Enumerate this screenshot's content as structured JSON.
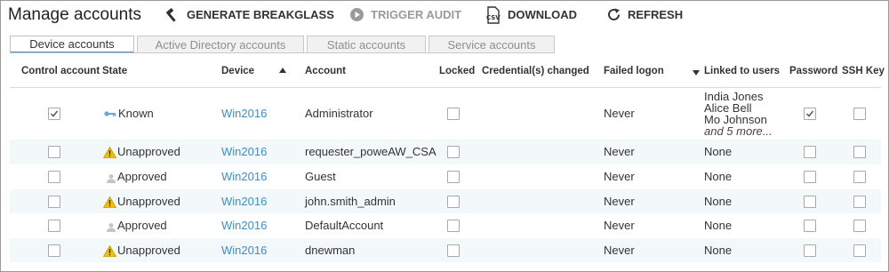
{
  "header": {
    "title": "Manage accounts",
    "actions": [
      {
        "label": "GENERATE BREAKGLASS",
        "icon": "hammer-icon",
        "enabled": true
      },
      {
        "label": "TRIGGER AUDIT",
        "icon": "play-circle-icon",
        "enabled": false
      },
      {
        "label": "DOWNLOAD",
        "icon": "csv-file-icon",
        "enabled": true
      },
      {
        "label": "REFRESH",
        "icon": "refresh-icon",
        "enabled": true
      }
    ]
  },
  "tabs": [
    {
      "label": "Device accounts",
      "active": true
    },
    {
      "label": "Active Directory accounts",
      "active": false
    },
    {
      "label": "Static accounts",
      "active": false
    },
    {
      "label": "Service accounts",
      "active": false
    }
  ],
  "table": {
    "columns": [
      "Control account",
      "State",
      "Device",
      "Account",
      "Locked",
      "Credential(s) changed",
      "Failed logon",
      "Linked to users",
      "Password",
      "SSH Key"
    ],
    "sort": {
      "ascending_column": "Device",
      "descending_column": "Linked to users"
    },
    "rows": [
      {
        "control": true,
        "state": "Known",
        "state_icon": "key-icon",
        "device": "Win2016",
        "account": "Administrator",
        "locked": false,
        "credentials_changed": "",
        "failed_logon": "Never",
        "linked_users": [
          "India Jones",
          "Alice Bell",
          "Mo Johnson"
        ],
        "linked_more": "and 5 more...",
        "password": true,
        "ssh_key": false
      },
      {
        "control": false,
        "state": "Unapproved",
        "state_icon": "warning-icon",
        "device": "Win2016",
        "account": "requester_poweAW_CSA",
        "locked": false,
        "credentials_changed": "",
        "failed_logon": "Never",
        "linked_users": [
          "None"
        ],
        "linked_more": "",
        "password": false,
        "ssh_key": false
      },
      {
        "control": false,
        "state": "Approved",
        "state_icon": "user-icon",
        "device": "Win2016",
        "account": "Guest",
        "locked": false,
        "credentials_changed": "",
        "failed_logon": "Never",
        "linked_users": [
          "None"
        ],
        "linked_more": "",
        "password": false,
        "ssh_key": false
      },
      {
        "control": false,
        "state": "Unapproved",
        "state_icon": "warning-icon",
        "device": "Win2016",
        "account": "john.smith_admin",
        "locked": false,
        "credentials_changed": "",
        "failed_logon": "Never",
        "linked_users": [
          "None"
        ],
        "linked_more": "",
        "password": false,
        "ssh_key": false
      },
      {
        "control": false,
        "state": "Approved",
        "state_icon": "user-icon",
        "device": "Win2016",
        "account": "DefaultAccount",
        "locked": false,
        "credentials_changed": "",
        "failed_logon": "Never",
        "linked_users": [
          "None"
        ],
        "linked_more": "",
        "password": false,
        "ssh_key": false
      },
      {
        "control": false,
        "state": "Unapproved",
        "state_icon": "warning-icon",
        "device": "Win2016",
        "account": "dnewman",
        "locked": false,
        "credentials_changed": "",
        "failed_logon": "Never",
        "linked_users": [
          "None"
        ],
        "linked_more": "",
        "password": false,
        "ssh_key": false
      }
    ]
  },
  "colors": {
    "link": "#3a8ed6",
    "tab_accent": "#4a90c8",
    "row_shade": "#f3f8fb",
    "warning": "#f2c200"
  }
}
